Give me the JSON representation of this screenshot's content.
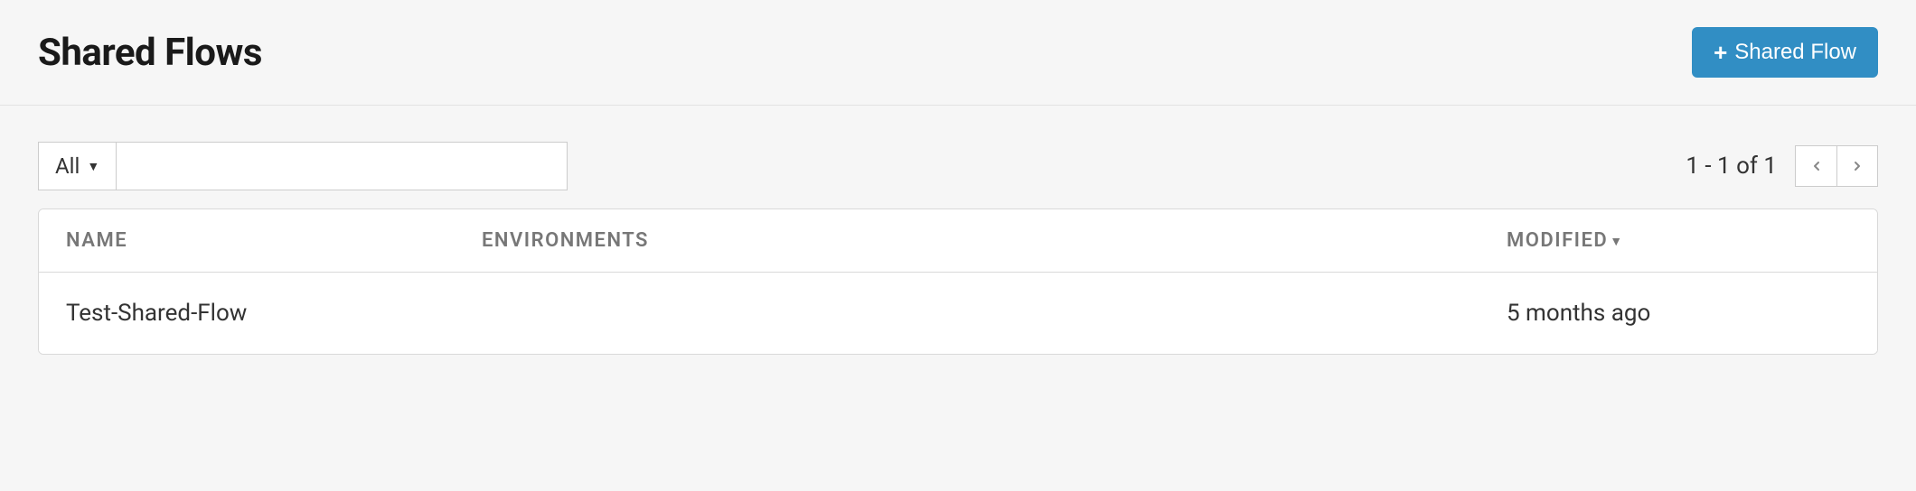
{
  "header": {
    "title": "Shared Flows",
    "createButton": "Shared Flow"
  },
  "filter": {
    "selected": "All",
    "searchValue": ""
  },
  "pagination": {
    "info": "1 - 1 of 1"
  },
  "table": {
    "columns": {
      "name": "NAME",
      "environments": "ENVIRONMENTS",
      "modified": "MODIFIED"
    },
    "sortIndicator": "▼",
    "rows": [
      {
        "name": "Test-Shared-Flow",
        "environments": "",
        "modified": "5 months ago"
      }
    ]
  }
}
